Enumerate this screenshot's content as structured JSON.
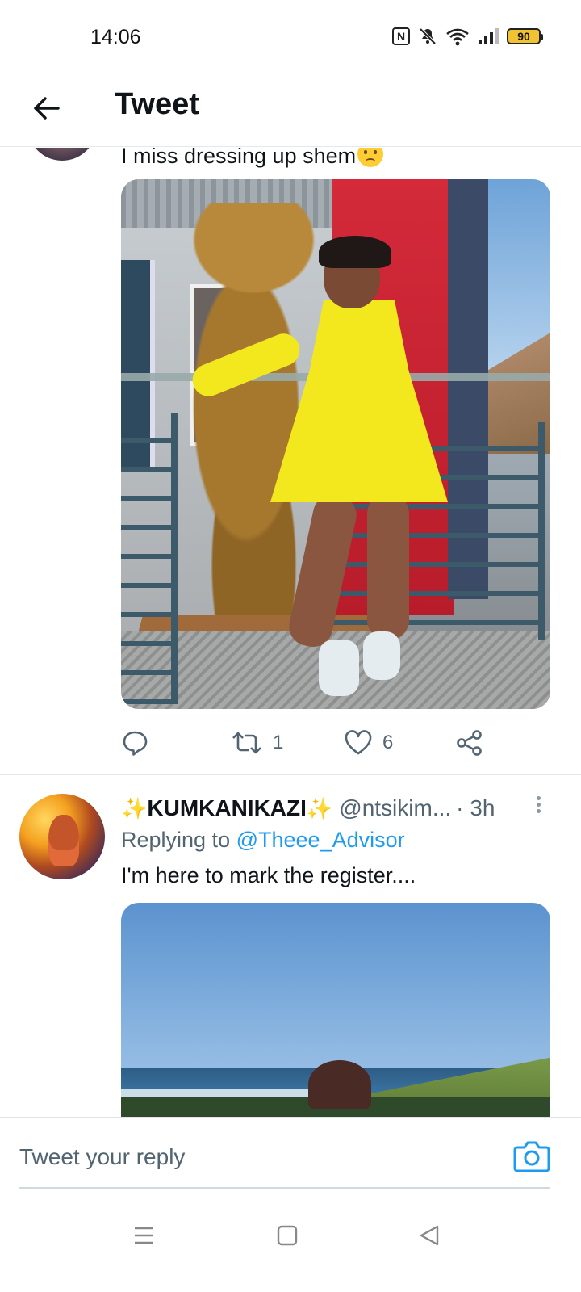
{
  "status_bar": {
    "time": "14:06",
    "battery": "90",
    "icons": [
      "nfc-icon",
      "mute-icon",
      "wifi-icon",
      "signal-icon",
      "battery-icon"
    ]
  },
  "header": {
    "title": "Tweet",
    "back_icon": "arrow-left-icon"
  },
  "tweets": [
    {
      "text": "I miss dressing up shem",
      "emoji": "sad-sweat-face-emoji",
      "actions": {
        "reply_count": "",
        "retweet_count": "1",
        "like_count": "6"
      }
    },
    {
      "sparkle_left": "✨",
      "name": "KUMKANIKAZI",
      "sparkle_right": "✨",
      "handle": "@ntsikim...",
      "time": "· 3h",
      "replying_to_label": "Replying to ",
      "replying_to_handle": "@Theee_Advisor",
      "text": "I'm here to mark the register...."
    }
  ],
  "reply_box": {
    "placeholder": "Tweet your reply",
    "camera_icon": "camera-icon"
  },
  "nav_bar": {
    "icons": [
      "menu-icon",
      "home-square-icon",
      "back-triangle-icon"
    ]
  },
  "colors": {
    "accent": "#1d9bf0",
    "text_primary": "#0f1419",
    "text_secondary": "#536471",
    "sparkle": "#f5b51a"
  }
}
